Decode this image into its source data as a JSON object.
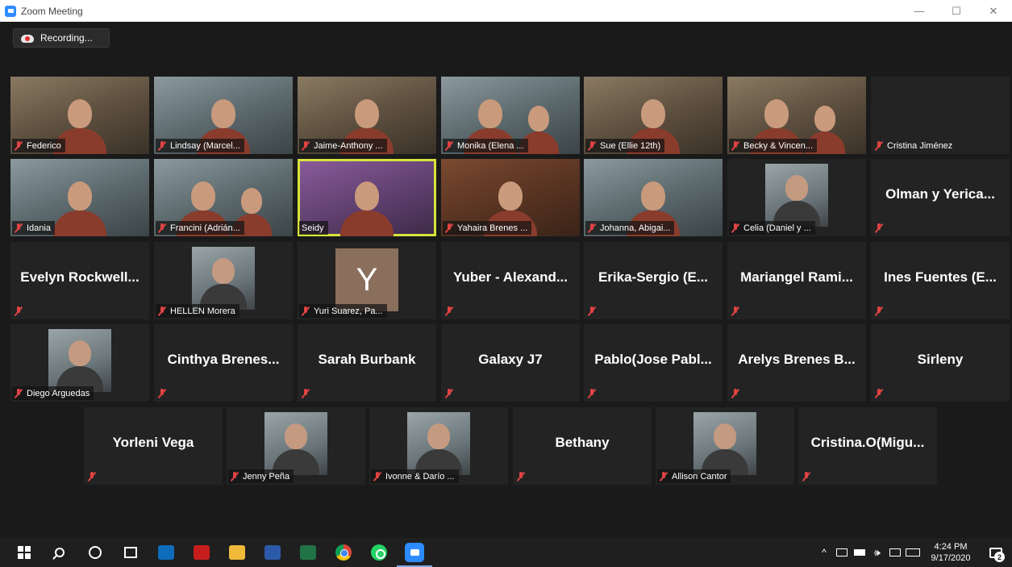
{
  "window": {
    "title": "Zoom Meeting",
    "controls": [
      "—",
      "☐",
      "✕"
    ]
  },
  "recording": {
    "label": "Recording..."
  },
  "participants": [
    {
      "name": "Federico",
      "kind": "video",
      "tone": "warm"
    },
    {
      "name": "Lindsay (Marcel...",
      "kind": "video",
      "tone": "cool"
    },
    {
      "name": "Jaime-Anthony ...",
      "kind": "video",
      "tone": "warm"
    },
    {
      "name": "Monika (Elena ...",
      "kind": "video2",
      "tone": "cool"
    },
    {
      "name": "Sue (Ellie 12th)",
      "kind": "video",
      "tone": "warm"
    },
    {
      "name": "Becky & Vincen...",
      "kind": "video2",
      "tone": "warm"
    },
    {
      "name": "Cristina Jiménez",
      "kind": "blank"
    },
    {
      "name": "Idania",
      "kind": "video",
      "tone": "cool"
    },
    {
      "name": "Francini (Adrián...",
      "kind": "video2",
      "tone": "cool"
    },
    {
      "name": "Seidy",
      "kind": "video",
      "tone": "purple",
      "active": true
    },
    {
      "name": "Yahaira Brenes ...",
      "kind": "video",
      "tone": "wood"
    },
    {
      "name": "Johanna, Abigai...",
      "kind": "video",
      "tone": "cool"
    },
    {
      "name": "Celia (Daniel y ...",
      "kind": "photo"
    },
    {
      "name": "Olman y Yerica...",
      "kind": "name"
    },
    {
      "name": "Evelyn Rockwell...",
      "kind": "name"
    },
    {
      "name": "HELLEN Morera",
      "kind": "photo"
    },
    {
      "name": "Yuri Suarez, Pa...",
      "kind": "initial",
      "initial": "Y"
    },
    {
      "name": "Yuber - Alexand...",
      "kind": "name"
    },
    {
      "name": "Erika-Sergio (E...",
      "kind": "name"
    },
    {
      "name": "Mariangel Rami...",
      "kind": "name"
    },
    {
      "name": "Ines Fuentes (E...",
      "kind": "name"
    },
    {
      "name": "Diego Arguedas",
      "kind": "photo"
    },
    {
      "name": "Cinthya Brenes...",
      "kind": "name"
    },
    {
      "name": "Sarah Burbank",
      "kind": "name"
    },
    {
      "name": "Galaxy J7",
      "kind": "name"
    },
    {
      "name": "Pablo(Jose Pabl...",
      "kind": "name"
    },
    {
      "name": "Arelys Brenes B...",
      "kind": "name"
    },
    {
      "name": "Sirleny",
      "kind": "name"
    },
    {
      "name": "Yorleni Vega",
      "kind": "name"
    },
    {
      "name": "Jenny Peña",
      "kind": "photo"
    },
    {
      "name": "Ivonne & Darío ...",
      "kind": "photo"
    },
    {
      "name": "Bethany",
      "kind": "name"
    },
    {
      "name": "Allison Cantor",
      "kind": "photo"
    },
    {
      "name": "Cristina.O(Migu...",
      "kind": "name"
    }
  ],
  "taskbar": {
    "apps": [
      {
        "name": "start",
        "icon": "windows-icon"
      },
      {
        "name": "search",
        "icon": "search-icon"
      },
      {
        "name": "cortana",
        "icon": "cortana-icon"
      },
      {
        "name": "task-view",
        "icon": "task-view-icon"
      },
      {
        "name": "outlook",
        "icon": "outlook-icon"
      },
      {
        "name": "acrobat",
        "icon": "acrobat-icon"
      },
      {
        "name": "file-explorer",
        "icon": "folder-icon"
      },
      {
        "name": "word",
        "icon": "word-icon"
      },
      {
        "name": "excel",
        "icon": "excel-icon"
      },
      {
        "name": "chrome",
        "icon": "chrome-icon"
      },
      {
        "name": "whatsapp",
        "icon": "whatsapp-icon"
      },
      {
        "name": "zoom",
        "icon": "zoom-icon",
        "running": true
      }
    ],
    "clock": {
      "time": "4:24 PM",
      "date": "9/17/2020"
    },
    "notification_count": "2",
    "tray_glyphs": {
      "chevron": "^",
      "volume": "🕪"
    }
  },
  "colors": {
    "zoom_blue": "#2d8cff",
    "active_speaker": "#d6e33a",
    "muted_red": "#e04343"
  }
}
